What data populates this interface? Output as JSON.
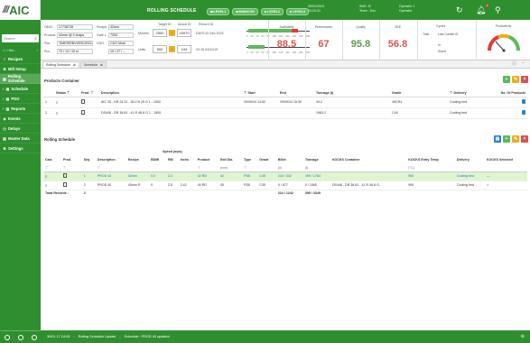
{
  "brand": {
    "slashes": "///",
    "name": "AIC"
  },
  "app_title": "ROLLING SCHEDULE",
  "levels": [
    {
      "label": "LEVEL1"
    },
    {
      "label": "MAINCON"
    },
    {
      "label": "LEVEL2"
    },
    {
      "label": "LEVEL3"
    }
  ],
  "top_info": {
    "datetime": "30/01/2024\n10:20:31",
    "shift": "Shift : B\nTeam : Dxx",
    "operator": "Operator 1\nOperator"
  },
  "notifications_badge": "2",
  "sidebar": {
    "search_placeholder": "Search",
    "home_label": "/ Ho..",
    "items": [
      {
        "icon": "≡",
        "label": "Recipes",
        "active": false,
        "icon_name": "recipes-icon"
      },
      {
        "icon": "⚙",
        "label": "Mill Setup",
        "active": false,
        "icon_name": "mill-setup-icon"
      },
      {
        "icon": "▦",
        "label": "Rolling Schedule",
        "active": true,
        "icon_name": "rolling-schedule-icon"
      },
      {
        "icon": "▣",
        "label": "Schedule",
        "active": false,
        "icon_name": "schedule-icon"
      },
      {
        "icon": "▤",
        "label": "PDO",
        "active": false,
        "icon_name": "pdo-icon"
      },
      {
        "icon": "▥",
        "label": "Reports",
        "active": false,
        "icon_name": "reports-icon"
      },
      {
        "icon": "◈",
        "label": "Events",
        "active": false,
        "icon_name": "events-icon"
      },
      {
        "icon": "◷",
        "label": "Delays",
        "active": false,
        "icon_name": "delays-icon"
      },
      {
        "icon": "▧",
        "label": "Master Data",
        "active": false,
        "icon_name": "master-data-icon"
      },
      {
        "icon": "⚙",
        "label": "Settings",
        "active": false,
        "icon_name": "settings-icon"
      }
    ]
  },
  "metrics": {
    "fields": {
      "heat_label": "HEAT",
      "heat_value": "17738728",
      "recipe_label": "Recipe",
      "recipe_value": "42mm",
      "product_label": "Product",
      "product_value": "42mm @ 0 chaps",
      "gate_label": "Gate L",
      "gate_value": "7200",
      "pdo_label": "Pdo",
      "pdo_value": "TIMER/RBVKRS/1R15",
      "cdo_label": "CDO",
      "cdo_value": "CDO Mold",
      "pcs_label": "Pcs",
      "pcs_value": "73 / 13 / 19 m",
      "pcs2_value": "19 / 27 / ..."
    },
    "target_label": "Target ID",
    "actual_label": "Actual ID",
    "record_label": "Record ID",
    "row1": {
      "label": "Months",
      "target": "2500",
      "actual": "24970",
      "record": "DAYS  ID  Dec 2023"
    },
    "row2": {
      "label": "Units",
      "target": "500",
      "actual": "194",
      "record": "2H  ID  04/31/19"
    },
    "scale_ticks": [
      "0",
      "20",
      "40",
      "60",
      "80",
      "100",
      "120",
      "140",
      "160",
      "180",
      "200"
    ],
    "kpis": [
      {
        "label": "Availability",
        "value": "88.5",
        "tone": "red"
      },
      {
        "label": "Performance",
        "value": "67",
        "tone": "red"
      },
      {
        "label": "Quality",
        "value": "95.8",
        "tone": "green"
      },
      {
        "label": "OEE",
        "value": "56.8",
        "tone": "red"
      }
    ],
    "cycle": {
      "title": "Cycles",
      "total_label": "Total",
      "total_value": "Last Cobble ID",
      "line1": "hr",
      "line2": "Stand"
    },
    "gauge_title": "Productivity"
  },
  "tabs": [
    {
      "label": "Rolling Schedule",
      "active": true
    },
    {
      "label": "Schedule",
      "active": false
    }
  ],
  "products_container": {
    "title": "Products Container",
    "headers": [
      "Status",
      "Prod.",
      "Description",
      "Start",
      "End",
      "Tonnage (t)",
      "Grade",
      "Delivery",
      "No. Of Products"
    ],
    "rows": [
      {
        "description": "AIC 35 - DR 24.31 - 36.2 B 29 G 1 - 1500",
        "start": "29/09/24 14:52",
        "end": "29/09/24 15:30",
        "tonnage": "34.2",
        "grade": "49CR4",
        "delivery": "Cooling bed"
      },
      {
        "description": "DS448 - DR 38.81 - 41 R 48.8 G 1 - 1500",
        "start": "",
        "end": "",
        "tonnage": "1983.2",
        "grade": "C45",
        "delivery": "Cooling bed"
      }
    ]
  },
  "rolling_schedule": {
    "title": "Rolling Schedule",
    "speed_header": "Speed (mps)",
    "headers": [
      "Calc",
      "Prod.",
      "Seq",
      "Description",
      "Recipe",
      "BDMI",
      "RM",
      "Inchs",
      "Product",
      "Exit Dia.",
      "Type",
      "Grade",
      "Billet",
      "Tonnage",
      "KOCKS Container",
      "KOCKS Entry Temp",
      "Delivery",
      "KOCKS Selected"
    ],
    "units": [
      "",
      "",
      "",
      "",
      "",
      "",
      "",
      "",
      "",
      "(mm)",
      "",
      "",
      "(#)",
      "(t)",
      "",
      "(°C)",
      "",
      ""
    ],
    "rows": [
      {
        "seq": "1",
        "description": "PROD 42",
        "recipe": "42mm",
        "bdmi": "0.0",
        "rm": "2.4",
        "inchs": "",
        "product": "42 RD",
        "exit_dia": "42",
        "type": "FSB",
        "grade": "C45",
        "billet": "224 / 342",
        "tonnage": "395 / 1784",
        "kocks_container": "",
        "kocks_temp": "950",
        "delivery": "Cooling bed",
        "selected": "—",
        "highlight": true
      },
      {
        "seq": "2",
        "description": "PROD 40",
        "recipe": "40mm R",
        "bdmi": "0",
        "rm": "2.5",
        "inchs": "2.42",
        "product": "40 RD",
        "exit_dia": "40",
        "type": "FSB",
        "grade": "C45",
        "billet": "0 / 877",
        "tonnage": "0 / 1565",
        "kocks_container": "DS448 - DR 38.81 - 41 R 48.8 G...",
        "kocks_temp": "950",
        "delivery": "Cooling bed",
        "selected": "✓",
        "highlight": false
      }
    ],
    "total_label": "Total Records :",
    "total_count": "2",
    "total_billet": "224 / 1242",
    "total_tonnage": "395 / 3349"
  },
  "statusbar": {
    "datetime": "30/01 17:24:05",
    "msg1": "Rolling Schedule Update",
    "msg2": "Schedule : PROD 40 updated"
  },
  "colors": {
    "primary": "#2f8f2f",
    "accent_yellow": "#f0ad1e",
    "highlight_row": "#dff5d0",
    "kpi_red": "#d9534f",
    "kpi_green": "#5a9b3b"
  }
}
